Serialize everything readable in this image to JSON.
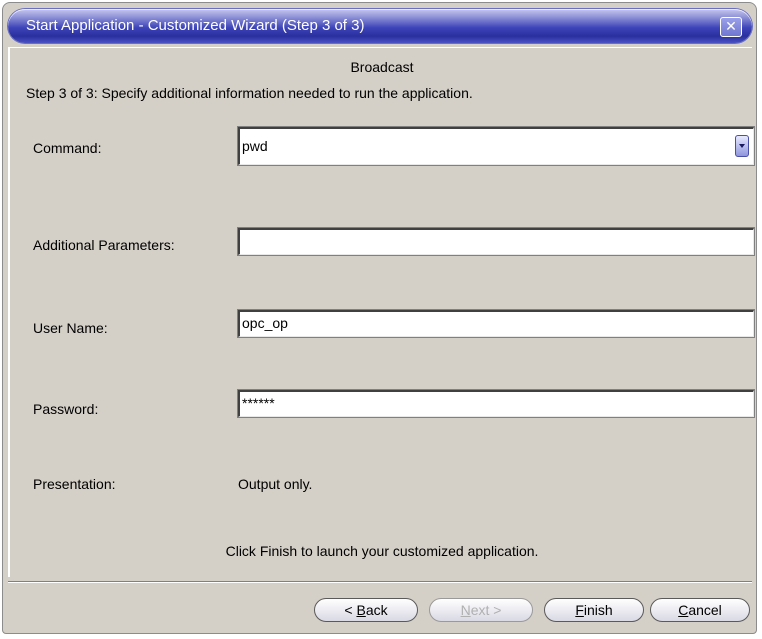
{
  "window": {
    "title": "Start Application - Customized Wizard (Step 3 of 3)",
    "close_glyph": "✕"
  },
  "wizard": {
    "heading": "Broadcast",
    "step_description": "Step 3 of 3: Specify additional information needed to run the application.",
    "command": {
      "label": "Command:",
      "value": "pwd"
    },
    "additional_parameters": {
      "label": "Additional Parameters:",
      "value": ""
    },
    "user_name": {
      "label": "User Name:",
      "value": "opc_op"
    },
    "password": {
      "label": "Password:",
      "value": "******"
    },
    "presentation": {
      "label": "Presentation:",
      "value": "Output only."
    },
    "footer_message": "Click Finish to launch your customized application."
  },
  "buttons": {
    "back": {
      "prefix": "< ",
      "mnemonic": "B",
      "rest": "ack"
    },
    "next": {
      "mnemonic": "N",
      "rest": "ext >"
    },
    "finish": {
      "mnemonic": "F",
      "rest": "inish"
    },
    "cancel": {
      "mnemonic": "C",
      "rest": "ancel"
    }
  },
  "colors": {
    "dialog_bg": "#d4d0c8",
    "titlebar": "#2a2f9e"
  }
}
